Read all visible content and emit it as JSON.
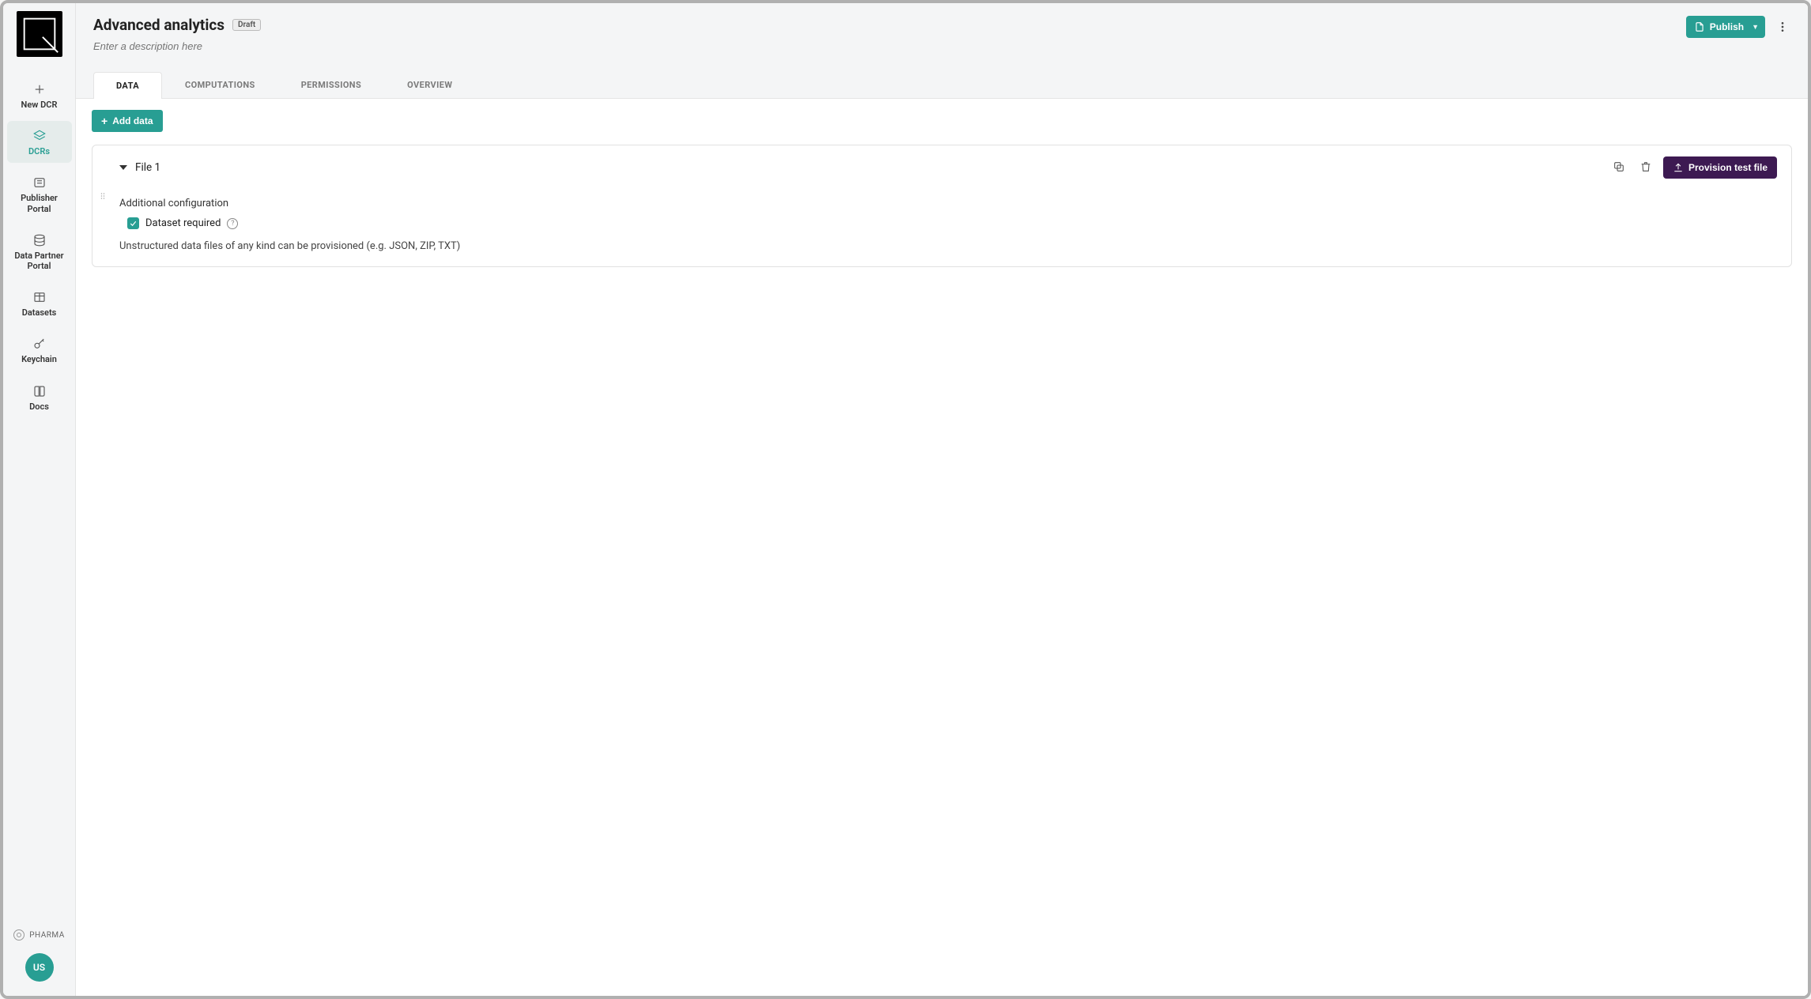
{
  "sidebar": {
    "items": [
      {
        "label": "New DCR"
      },
      {
        "label": "DCRs"
      },
      {
        "label": "Publisher Portal"
      },
      {
        "label": "Data Partner Portal"
      },
      {
        "label": "Datasets"
      },
      {
        "label": "Keychain"
      },
      {
        "label": "Docs"
      }
    ],
    "org_label": "PHARMA",
    "avatar": "US"
  },
  "header": {
    "title": "Advanced analytics",
    "status_badge": "Draft",
    "description_placeholder": "Enter a description here",
    "publish_label": "Publish"
  },
  "tabs": [
    {
      "label": "DATA",
      "active": true
    },
    {
      "label": "COMPUTATIONS",
      "active": false
    },
    {
      "label": "PERMISSIONS",
      "active": false
    },
    {
      "label": "OVERVIEW",
      "active": false
    }
  ],
  "toolbar": {
    "add_data_label": "Add data"
  },
  "data_card": {
    "title": "File 1",
    "provision_label": "Provision test file",
    "additional_config_label": "Additional configuration",
    "dataset_required_label": "Dataset required",
    "dataset_required_checked": true,
    "hint": "Unstructured data files of any kind can be provisioned (e.g. JSON, ZIP, TXT)"
  }
}
